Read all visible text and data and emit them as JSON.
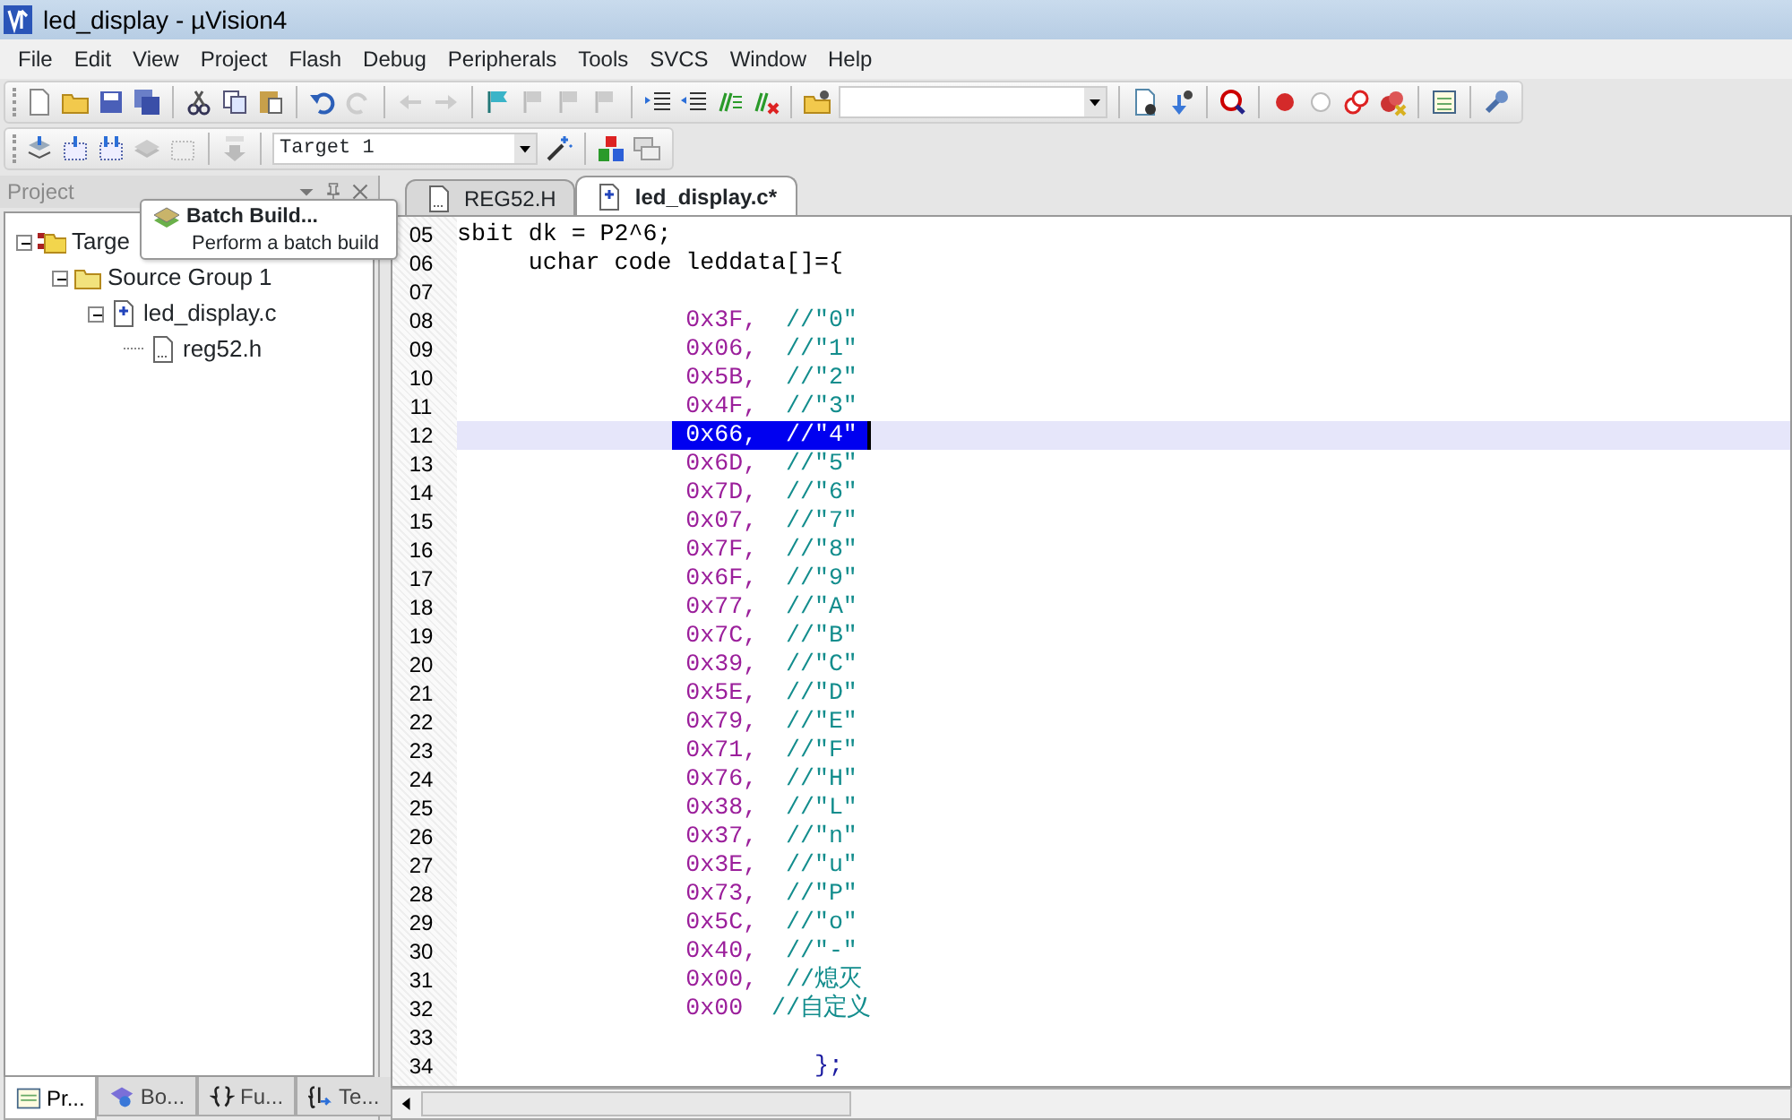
{
  "window": {
    "title": "led_display  - µVision4"
  },
  "menu": [
    "File",
    "Edit",
    "View",
    "Project",
    "Flash",
    "Debug",
    "Peripherals",
    "Tools",
    "SVCS",
    "Window",
    "Help"
  ],
  "target_select": {
    "value": "Target 1"
  },
  "project_panel": {
    "title": "Project",
    "tree": [
      {
        "label": "Targe",
        "kind": "target",
        "expanded": true,
        "children": [
          {
            "label": "Source Group 1",
            "kind": "group",
            "expanded": true,
            "children": [
              {
                "label": "led_display.c",
                "kind": "source",
                "expanded": true,
                "children": [
                  {
                    "label": "reg52.h",
                    "kind": "header"
                  }
                ]
              }
            ]
          }
        ]
      }
    ],
    "tabs": [
      {
        "label": "Pr...",
        "selected": true
      },
      {
        "label": "Bo...",
        "selected": false
      },
      {
        "label": "Fu...",
        "selected": false
      },
      {
        "label": "Te...",
        "selected": false
      }
    ]
  },
  "tooltip": {
    "title": "Batch Build...",
    "text": "Perform a batch build"
  },
  "editor_tabs": [
    {
      "label": "REG52.H",
      "selected": false
    },
    {
      "label": "led_display.c*",
      "selected": true
    }
  ],
  "code_lines": [
    {
      "number": "05",
      "kind": "top",
      "text": "sbit dk = P2^6;",
      "selected": false
    },
    {
      "number": "06",
      "kind": "inner",
      "text": "uchar code leddata[]={",
      "selected": false
    },
    {
      "number": "07",
      "kind": "blank",
      "selected": false
    },
    {
      "number": "08",
      "kind": "entry",
      "value": "0x3F,",
      "comment": "//\"0\"",
      "selected": false
    },
    {
      "number": "09",
      "kind": "entry",
      "value": "0x06,",
      "comment": "//\"1\"",
      "selected": false
    },
    {
      "number": "10",
      "kind": "entry",
      "value": "0x5B,",
      "comment": "//\"2\"",
      "selected": false
    },
    {
      "number": "11",
      "kind": "entry",
      "value": "0x4F,",
      "comment": "//\"3\"",
      "selected": false
    },
    {
      "number": "12",
      "kind": "entry",
      "value": "0x66,",
      "comment": "//\"4\"",
      "selected": true
    },
    {
      "number": "13",
      "kind": "entry",
      "value": "0x6D,",
      "comment": "//\"5\"",
      "selected": false
    },
    {
      "number": "14",
      "kind": "entry",
      "value": "0x7D,",
      "comment": "//\"6\"",
      "selected": false
    },
    {
      "number": "15",
      "kind": "entry",
      "value": "0x07,",
      "comment": "//\"7\"",
      "selected": false
    },
    {
      "number": "16",
      "kind": "entry",
      "value": "0x7F,",
      "comment": "//\"8\"",
      "selected": false
    },
    {
      "number": "17",
      "kind": "entry",
      "value": "0x6F,",
      "comment": "//\"9\"",
      "selected": false
    },
    {
      "number": "18",
      "kind": "entry",
      "value": "0x77,",
      "comment": "//\"A\"",
      "selected": false
    },
    {
      "number": "19",
      "kind": "entry",
      "value": "0x7C,",
      "comment": "//\"B\"",
      "selected": false
    },
    {
      "number": "20",
      "kind": "entry",
      "value": "0x39,",
      "comment": "//\"C\"",
      "selected": false
    },
    {
      "number": "21",
      "kind": "entry",
      "value": "0x5E,",
      "comment": "//\"D\"",
      "selected": false
    },
    {
      "number": "22",
      "kind": "entry",
      "value": "0x79,",
      "comment": "//\"E\"",
      "selected": false
    },
    {
      "number": "23",
      "kind": "entry",
      "value": "0x71,",
      "comment": "//\"F\"",
      "selected": false
    },
    {
      "number": "24",
      "kind": "entry",
      "value": "0x76,",
      "comment": "//\"H\"",
      "selected": false
    },
    {
      "number": "25",
      "kind": "entry",
      "value": "0x38,",
      "comment": "//\"L\"",
      "selected": false
    },
    {
      "number": "26",
      "kind": "entry",
      "value": "0x37,",
      "comment": "//\"n\"",
      "selected": false
    },
    {
      "number": "27",
      "kind": "entry",
      "value": "0x3E,",
      "comment": "//\"u\"",
      "selected": false
    },
    {
      "number": "28",
      "kind": "entry",
      "value": "0x73,",
      "comment": "//\"P\"",
      "selected": false
    },
    {
      "number": "29",
      "kind": "entry",
      "value": "0x5C,",
      "comment": "//\"o\"",
      "selected": false
    },
    {
      "number": "30",
      "kind": "entry",
      "value": "0x40,",
      "comment": "//\"-\"",
      "selected": false
    },
    {
      "number": "31",
      "kind": "entry",
      "value": "0x00,",
      "comment": "//熄灭",
      "selected": false
    },
    {
      "number": "32",
      "kind": "entry",
      "value": "0x00",
      "comment": "//自定义",
      "selected": false
    },
    {
      "number": "33",
      "kind": "blank",
      "selected": false
    },
    {
      "number": "34",
      "kind": "end",
      "text": "};",
      "selected": false
    }
  ]
}
